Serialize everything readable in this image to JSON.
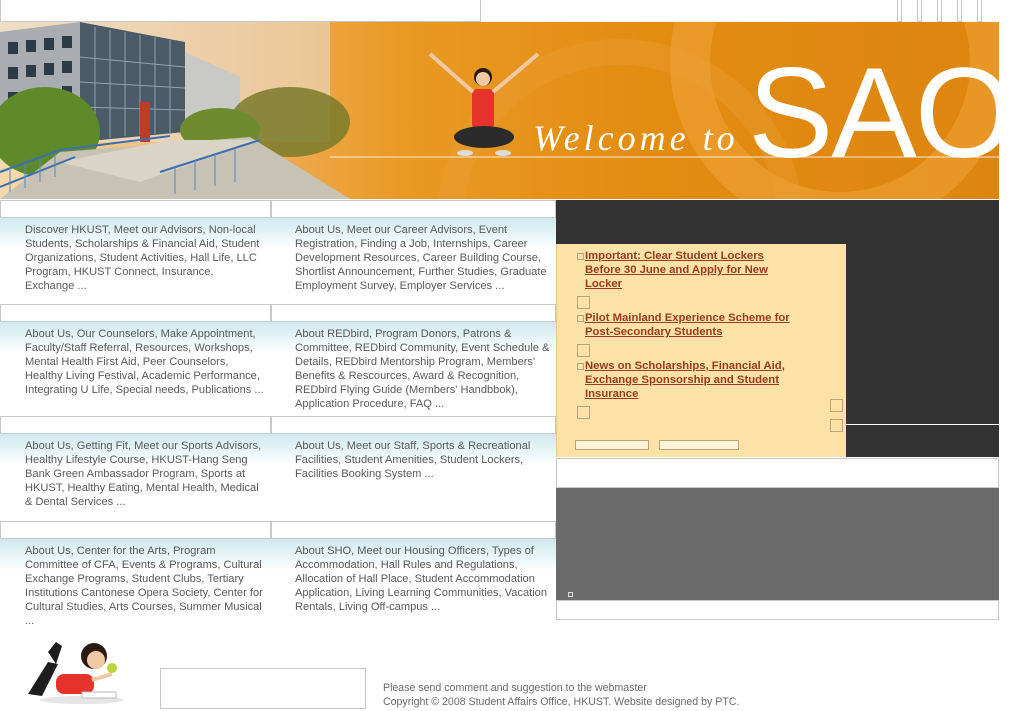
{
  "banner": {
    "welcome_text": "Welcome to",
    "brand": "SAO"
  },
  "services": [
    {
      "left": "Discover HKUST, Meet our Advisors, Non-local Students, Scholarships & Financial Aid, Student Organizations, Student Activities, Hall Life, LLC Program, HKUST Connect, Insurance, Exchange ...",
      "right": "About Us, Meet our Career Advisors, Event Registration, Finding a Job, Internships, Career Development Resources, Career Building Course, Shortlist Announcement, Further Studies, Graduate Employment Survey, Employer Services ..."
    },
    {
      "left": "About Us, Our Counselors, Make Appointment, Faculty/Staff Referral, Resources, Workshops, Mental Health First Aid, Peer Counselors, Healthy Living Festival, Academic Performance, Integrating U Life, Special needs, Publications ...",
      "right": "About REDbird, Program Donors, Patrons & Committee, REDbird Community, Event Schedule & Details, REDbird Mentorship Program, Members' Benefits & Rescources, Award & Recognition, REDbird Flying Guide (Members' Handbbok), Application Procedure, FAQ ..."
    },
    {
      "left": "About Us, Getting Fit, Meet our Sports Advisors, Healthy Lifestyle Course, HKUST-Hang Seng Bank Green Ambassador Program, Sports at HKUST, Healthy Eating, Mental Health, Medical & Dental Services ...",
      "right": "About Us, Meet our Staff, Sports & Recreational Facilities, Student Amenities, Student Lockers, Facilities Booking System ..."
    },
    {
      "left": "About Us, Center for the Arts, Program Committee of CFA, Events & Programs, Cultural Exchange Programs, Student Clubs, Tertiary Institutions Cantonese Opera Society, Center for Cultural Studies, Arts Courses, Summer Musical ...",
      "right": "About SHO, Meet our Housing Officers, Types of Accommodation, Hall Rules and Regulations, Allocation of Hall Place, Student Accommodation Application, Living Learning Communities, Vacation Rentals, Living Off-campus ..."
    }
  ],
  "news": [
    {
      "title": "Important: Clear Student Lockers Before 30 June and Apply for New Locker"
    },
    {
      "title": "Pilot Mainland Experience Scheme for Post-Secondary Students"
    },
    {
      "title": "News on Scholarships, Financial Aid, Exchange Sponsorship and Student Insurance"
    }
  ],
  "footer": {
    "line1": "Please send comment and suggestion to the webmaster",
    "line2": "Copyright © 2008 Student Affairs Office, HKUST. Website designed by PTC."
  },
  "colors": {
    "accent_orange": "#e38c12",
    "news_bg": "#fde2a8",
    "news_link": "#9a3b1e",
    "dark_panel": "#333333"
  }
}
